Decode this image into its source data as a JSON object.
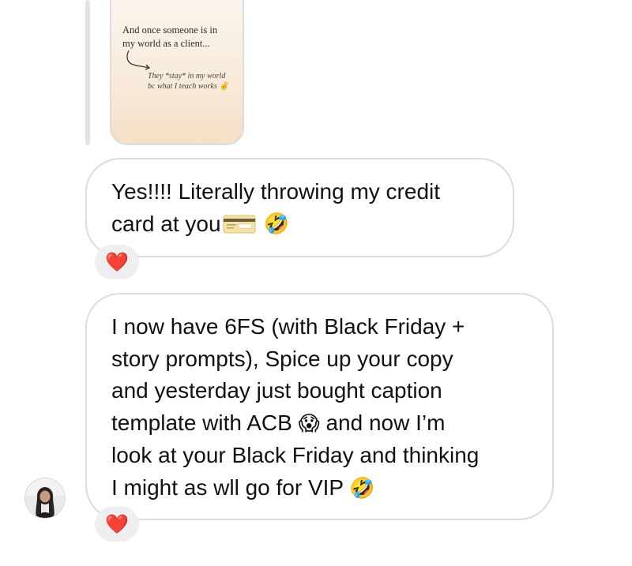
{
  "thread": {
    "shared_story": {
      "text_line1": "And once someone is in",
      "text_line2": "my world as a client...",
      "subtext_line1": "They *stay* in my world",
      "subtext_line2": "bc what I teach works ✌"
    },
    "messages": [
      {
        "lines": [
          "Yes!!!! Literally throwing my credit",
          "card at you "
        ],
        "emojis": [
          "credit-card",
          "🤣"
        ],
        "reaction": "❤️"
      },
      {
        "lines": [
          "I now have 6FS (with Black Friday +",
          "story prompts), Spice up your copy",
          "and yesterday just bought caption",
          "template with ACB ",
          " and now I’m",
          "look at your Black Friday and thinking",
          "I might as wll go for VIP "
        ],
        "emojis": [
          "😱",
          "🤣"
        ],
        "reaction": "❤️"
      }
    ]
  },
  "colors": {
    "bubble_border": "#dcdcdf",
    "reaction_bg": "#efeff1",
    "heart": "#e8202a"
  },
  "icons": {
    "card": "credit-card-emoji",
    "laugh": "rolling-laughing-emoji",
    "scream": "screaming-face-emoji",
    "heart": "red-heart-emoji"
  }
}
